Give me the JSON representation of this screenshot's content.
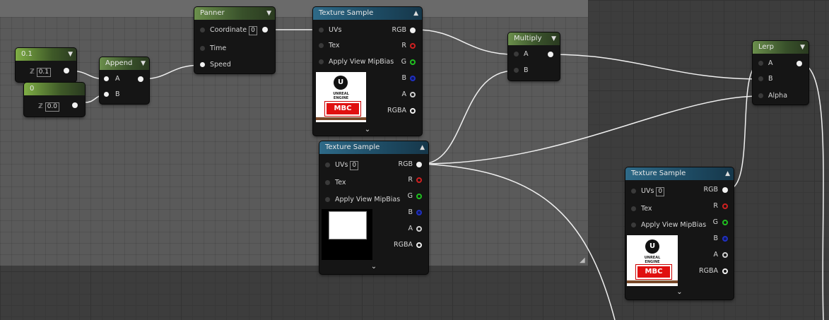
{
  "constants": [
    {
      "title": "0.1",
      "value": "0.1",
      "icon": "axis-gizmo-icon"
    },
    {
      "title": "0",
      "value": "0.0",
      "icon": "axis-gizmo-icon"
    }
  ],
  "append": {
    "title": "Append",
    "pins": [
      "A",
      "B"
    ]
  },
  "panner": {
    "title": "Panner",
    "pins": {
      "coordinate": "Coordinate",
      "coordinate_value": "0",
      "time": "Time",
      "speed": "Speed"
    }
  },
  "texture_sample_1": {
    "title": "Texture Sample",
    "inputs": [
      "UVs",
      "Tex",
      "Apply View MipBias"
    ],
    "outputs": [
      "RGB",
      "R",
      "G",
      "B",
      "A",
      "RGBA"
    ],
    "preview": {
      "logo": "UNREAL",
      "logo_sub": "ENGINE",
      "badge": "MBC"
    }
  },
  "texture_sample_2": {
    "title": "Texture Sample",
    "uvs_value": "0",
    "inputs": [
      "UVs",
      "Tex",
      "Apply View MipBias"
    ],
    "outputs": [
      "RGB",
      "R",
      "G",
      "B",
      "A",
      "RGBA"
    ]
  },
  "texture_sample_3": {
    "title": "Texture Sample",
    "uvs_value": "0",
    "inputs": [
      "UVs",
      "Tex",
      "Apply View MipBias"
    ],
    "outputs": [
      "RGB",
      "R",
      "G",
      "B",
      "A",
      "RGBA"
    ],
    "preview": {
      "logo": "UNREAL",
      "logo_sub": "ENGINE",
      "badge": "MBC"
    }
  },
  "multiply": {
    "title": "Multiply",
    "pins": [
      "A",
      "B"
    ]
  },
  "lerp": {
    "title": "Lerp",
    "pins": [
      "A",
      "B",
      "Alpha"
    ]
  },
  "colors": {
    "r": "#d02020",
    "g": "#20c020",
    "b": "#2030c0",
    "a": "#d0d0d0",
    "wire": "#f0f0f0"
  }
}
